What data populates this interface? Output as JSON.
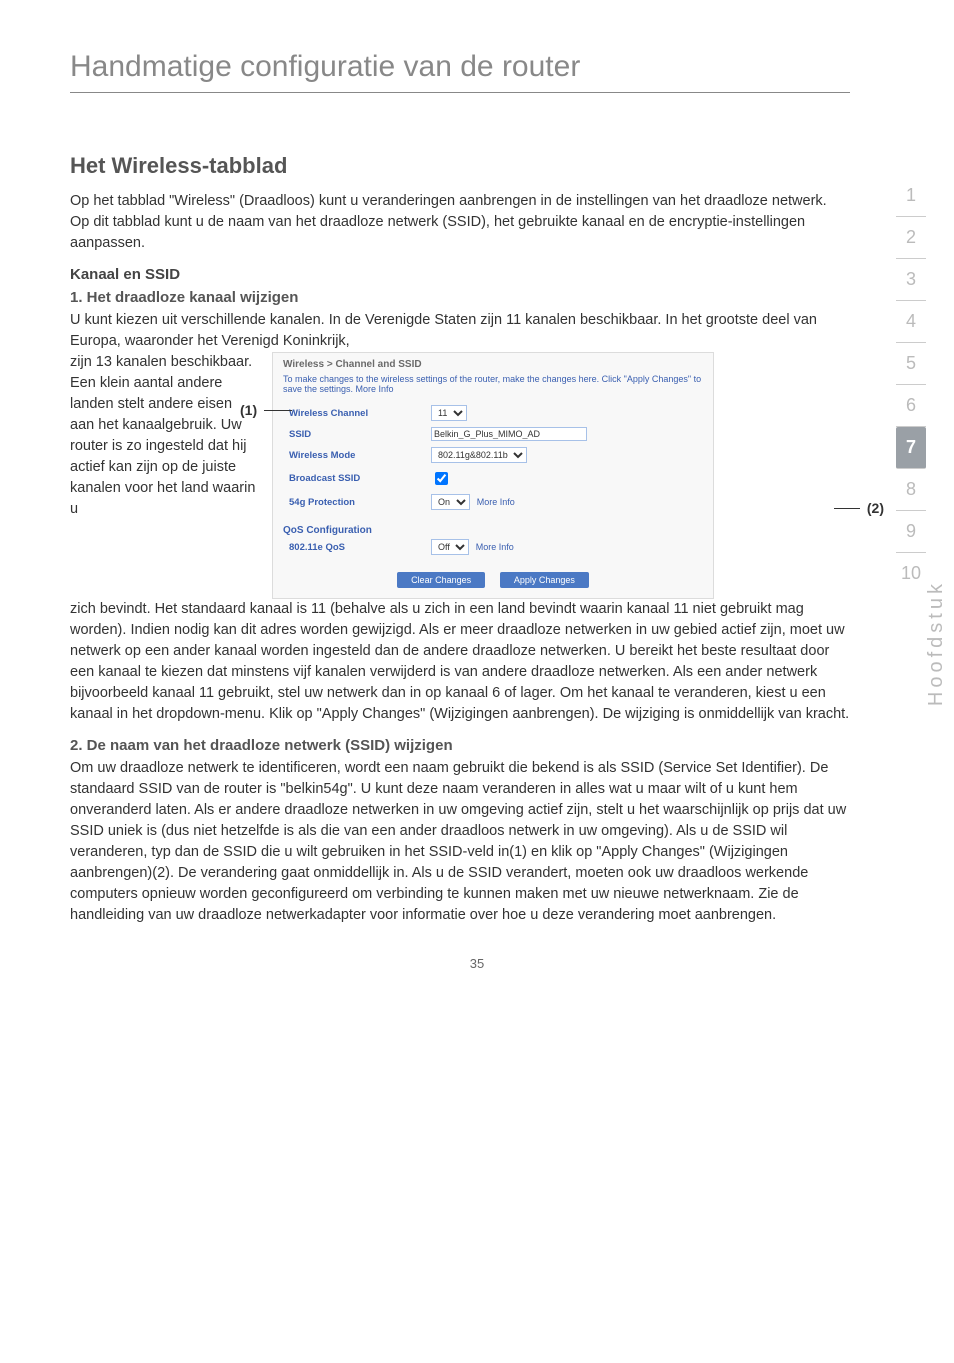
{
  "chapter_title": "Handmatige configuratie van de router",
  "section_title": "Het Wireless-tabblad",
  "lead_paragraph": "Op het tabblad \"Wireless\" (Draadloos) kunt u veranderingen aanbrengen in de instellingen van het draadloze netwerk. Op dit tabblad kunt u de naam van het draadloze netwerk (SSID), het gebruikte kanaal en de encryptie-instellingen aanpassen.",
  "subsec_title": "Kanaal en SSID",
  "step1_title": "1. Het draadloze kanaal wijzigen",
  "step1_intro": "U kunt kiezen uit verschillende kanalen. In de Verenigde Staten zijn 11 kanalen beschikbaar. In het grootste deel van Europa, waaronder het Verenigd Koninkrijk,",
  "step1_left": "zijn 13 kanalen beschikbaar. Een klein aantal andere landen stelt andere eisen aan het kanaalgebruik. Uw router is zo ingesteld dat hij actief kan zijn op de juiste kanalen voor het land waarin u",
  "step1_after": "zich bevindt. Het standaard kanaal is 11 (behalve als u zich in een land bevindt waarin kanaal 11 niet gebruikt mag worden). Indien nodig kan dit adres worden gewijzigd. Als er meer draadloze netwerken in uw gebied actief zijn, moet uw netwerk op een ander kanaal worden ingesteld dan de andere draadloze netwerken. U bereikt het beste resultaat door een kanaal te kiezen dat minstens vijf kanalen verwijderd is van andere draadloze netwerken. Als een ander netwerk bijvoorbeeld kanaal 11 gebruikt, stel uw netwerk dan in op kanaal 6 of lager. Om het kanaal te veranderen, kiest u een kanaal in het dropdown-menu. Klik op \"Apply Changes\" (Wijzigingen aanbrengen). De wijziging is onmiddellijk van kracht.",
  "step2_title": "2. De naam van het draadloze netwerk (SSID) wijzigen",
  "step2_body": "Om uw draadloze netwerk te identificeren, wordt een naam gebruikt die bekend is als SSID (Service Set Identifier). De standaard SSID van de router is \"belkin54g\". U kunt deze naam veranderen in alles wat u maar wilt of u kunt hem onveranderd laten. Als er andere draadloze netwerken in uw omgeving actief zijn, stelt u het waarschijnlijk op prijs dat uw SSID uniek is (dus niet hetzelfde is als die van een ander draadloos netwerk in uw omgeving). Als u de SSID wil veranderen, typ dan de SSID die u wilt gebruiken in het SSID-veld in(1) en klik op \"Apply Changes\" (Wijzigingen aanbrengen)(2). De verandering gaat onmiddellijk in. Als u de SSID verandert, moeten ook uw draadloos werkende computers opnieuw worden geconfigureerd om verbinding te kunnen maken met uw nieuwe netwerknaam. Zie de handleiding van uw draadloze netwerkadapter voor informatie over hoe u deze verandering moet aanbrengen.",
  "callout1": "(1)",
  "callout2": "(2)",
  "screenshot": {
    "crumb": "Wireless > Channel and SSID",
    "desc": "To make changes to the wireless settings of the router, make the changes here. Click \"Apply Changes\" to save the settings. More Info",
    "rows": {
      "wireless_channel_label": "Wireless Channel",
      "wireless_channel_value": "11",
      "ssid_label": "SSID",
      "ssid_value": "Belkin_G_Plus_MIMO_AD",
      "wireless_mode_label": "Wireless Mode",
      "wireless_mode_value": "802.11g&802.11b",
      "broadcast_label": "Broadcast SSID",
      "broadcast_checked": "true",
      "protection_label": "54g Protection",
      "protection_value": "On",
      "more_info": "More Info"
    },
    "qos_header": "QoS Configuration",
    "qos_label": "802.11e QoS",
    "qos_value": "Off",
    "clear_btn": "Clear Changes",
    "apply_btn": "Apply Changes"
  },
  "side_nav": [
    "1",
    "2",
    "3",
    "4",
    "5",
    "6",
    "7",
    "8",
    "9",
    "10"
  ],
  "side_nav_active_index": 6,
  "side_label": "Hoofdstuk",
  "page_number": "35"
}
